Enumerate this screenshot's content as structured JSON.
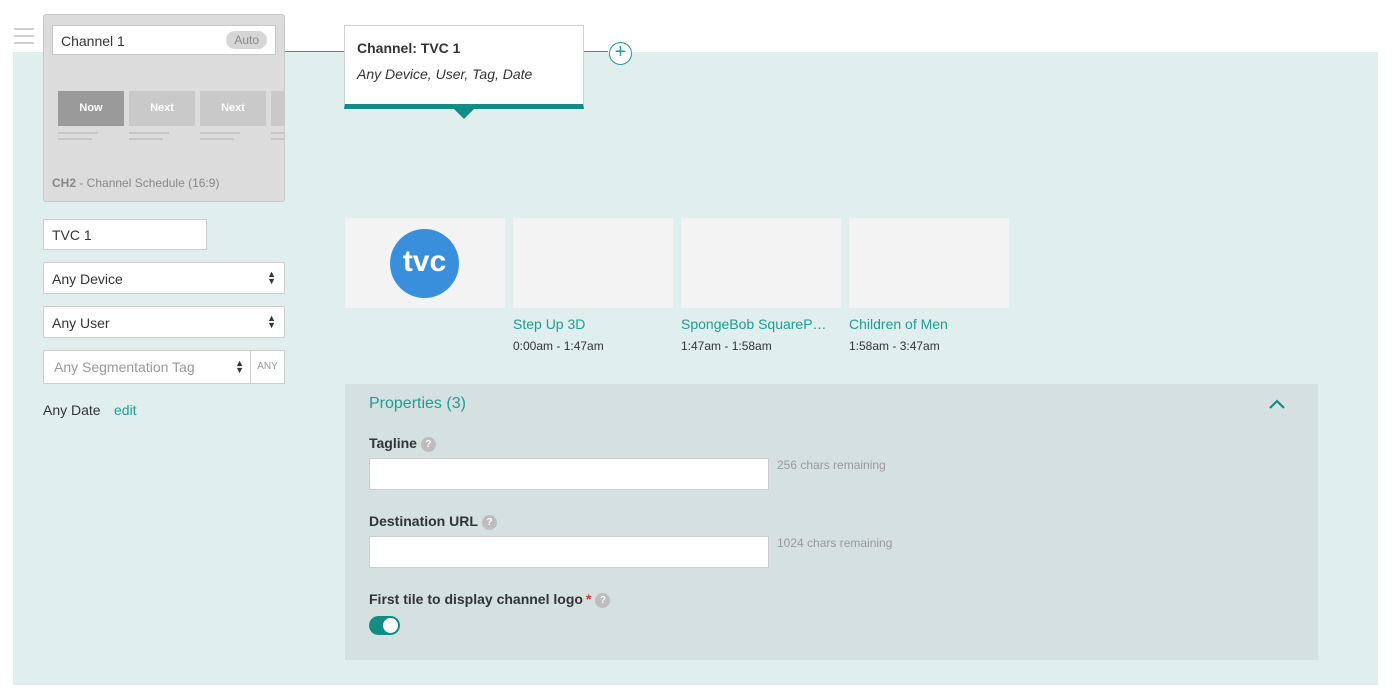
{
  "channel_card": {
    "name": "Channel 1",
    "badge": "Auto",
    "tiles": [
      "Now",
      "Next",
      "Next"
    ],
    "caption_code": "CH2",
    "caption_text": " - Channel Schedule (16:9)"
  },
  "filters": {
    "tvc_value": "TVC 1",
    "device": "Any Device",
    "user": "Any User",
    "segmentation_placeholder": "Any Segmentation Tag",
    "any_label": "ANY",
    "date_label": "Any Date",
    "edit_label": "edit"
  },
  "tooltip": {
    "title": "Channel: TVC 1",
    "subtitle": "Any Device, User, Tag, Date"
  },
  "schedule": {
    "logo_text": "tvc",
    "programs": [
      {
        "title": "Step Up 3D",
        "time": "0:00am - 1:47am"
      },
      {
        "title": "SpongeBob SquareP…",
        "time": "1:47am - 1:58am"
      },
      {
        "title": "Children of Men",
        "time": "1:58am - 3:47am"
      }
    ]
  },
  "properties": {
    "title": "Properties (3)",
    "tagline_label": "Tagline",
    "tagline_remaining": "256 chars remaining",
    "url_label": "Destination URL",
    "url_remaining": "1024 chars remaining",
    "logo_toggle_label": "First tile to display channel logo",
    "required_mark": "*",
    "help_glyph": "?"
  },
  "colors": {
    "accent": "#1f9c93",
    "stage_bg": "#e0eeed",
    "logo_blue": "#3a8fdd"
  }
}
